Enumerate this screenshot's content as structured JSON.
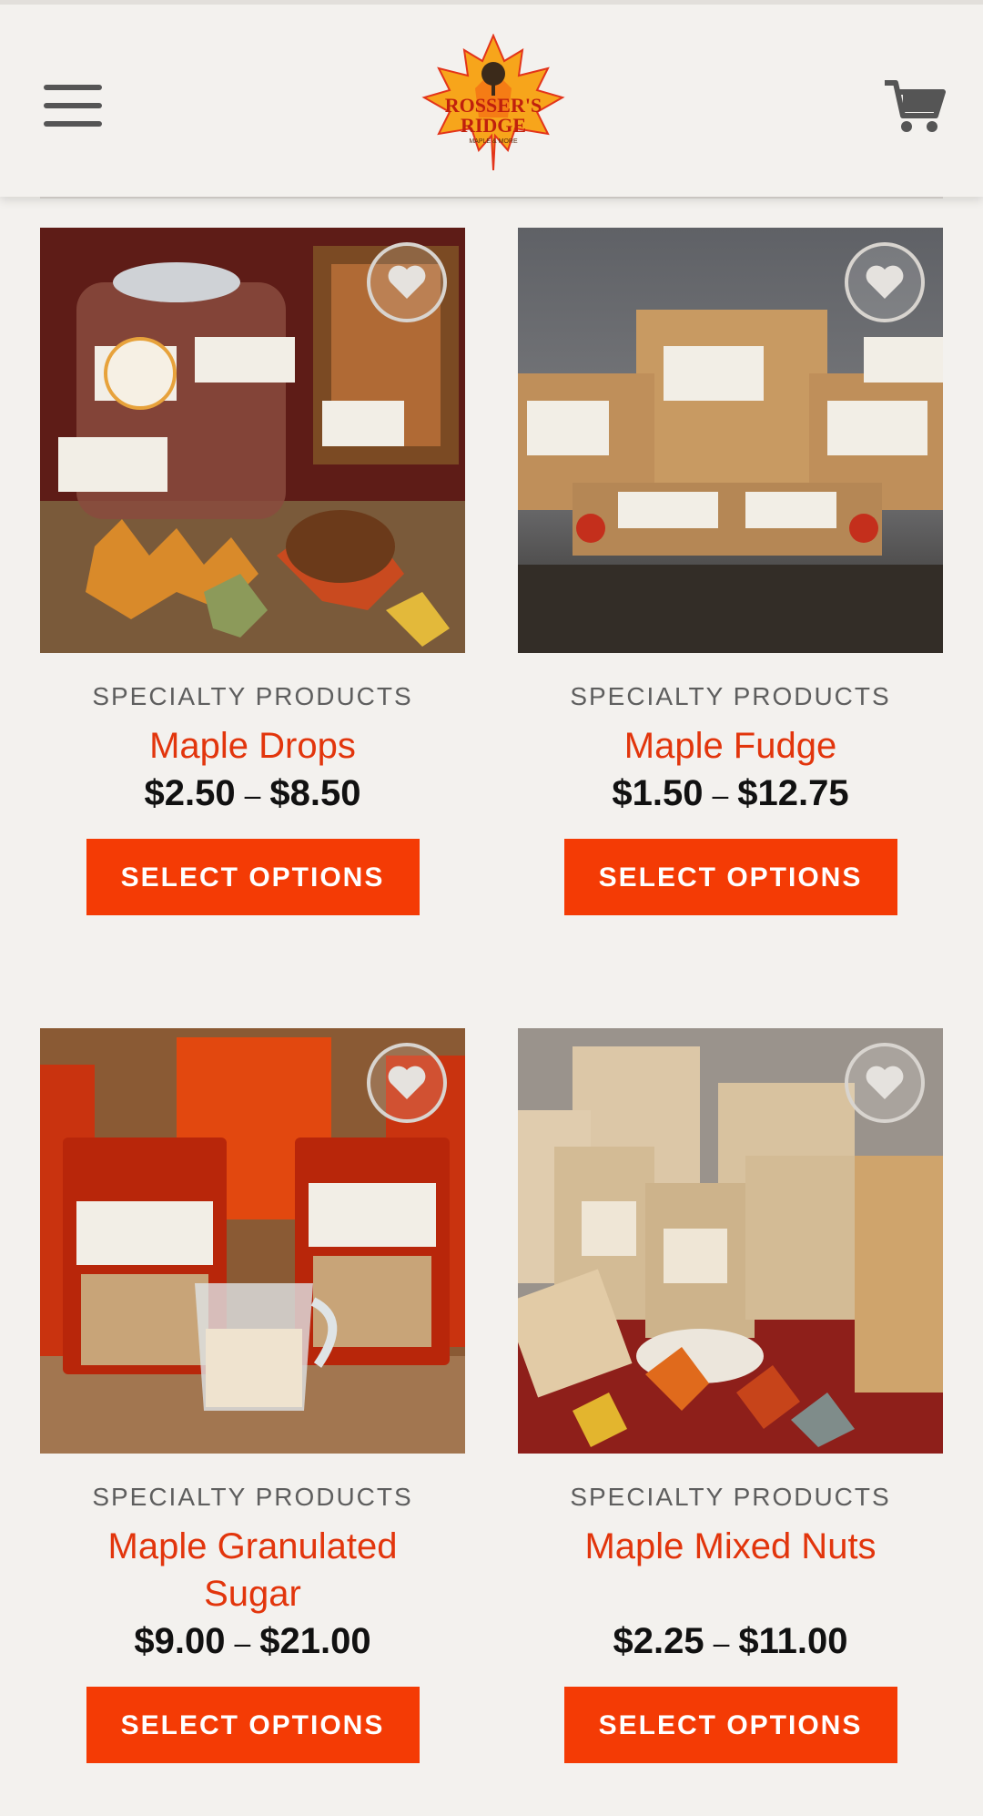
{
  "header": {
    "logo_line1": "ROSSER'S",
    "logo_line2": "RIDGE",
    "logo_tagline": "MAPLE & MORE",
    "menu_icon": "hamburger-menu-icon",
    "cart_icon": "shopping-cart-icon"
  },
  "colors": {
    "accent": "#f43b05",
    "product_name": "#e2350c",
    "background": "#f3f1ee"
  },
  "products": [
    {
      "category": "SPECIALTY PRODUCTS",
      "name": "Maple Drops",
      "price_min": "$2.50",
      "price_sep": "–",
      "price_max": "$8.50",
      "button": "SELECT OPTIONS",
      "wishlist_icon": "heart-icon"
    },
    {
      "category": "SPECIALTY PRODUCTS",
      "name": "Maple Fudge",
      "price_min": "$1.50",
      "price_sep": "–",
      "price_max": "$12.75",
      "button": "SELECT OPTIONS",
      "wishlist_icon": "heart-icon"
    },
    {
      "category": "SPECIALTY PRODUCTS",
      "name": "Maple Granulated Sugar",
      "price_min": "$9.00",
      "price_sep": "–",
      "price_max": "$21.00",
      "button": "SELECT OPTIONS",
      "wishlist_icon": "heart-icon"
    },
    {
      "category": "SPECIALTY PRODUCTS",
      "name": "Maple Mixed Nuts",
      "price_min": "$2.25",
      "price_sep": "–",
      "price_max": "$11.00",
      "button": "SELECT OPTIONS",
      "wishlist_icon": "heart-icon"
    }
  ]
}
